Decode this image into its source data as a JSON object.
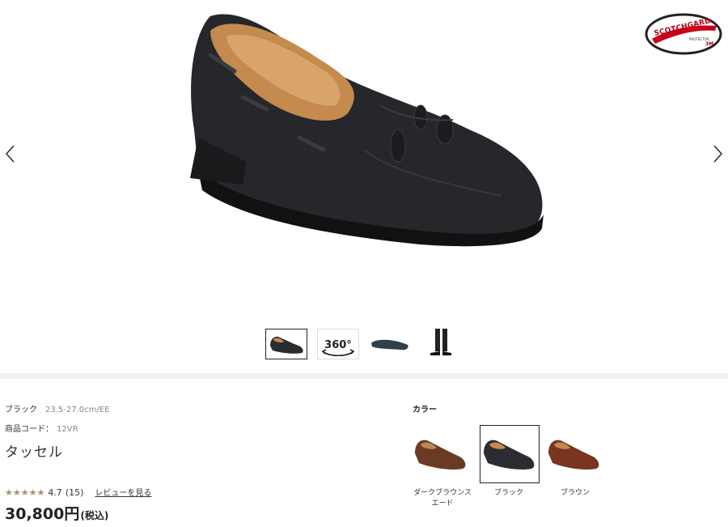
{
  "badge": {
    "brand": "SCOTCHGARD",
    "sub": "PROTECTOR",
    "maker": "3M"
  },
  "nav": {
    "prev_icon": "chevron-left-icon",
    "next_icon": "chevron-right-icon"
  },
  "thumbnails": [
    {
      "kind": "shoe-photo",
      "selected": true
    },
    {
      "kind": "360-view",
      "label": "360°"
    },
    {
      "kind": "sole-photo"
    },
    {
      "kind": "worn-photo"
    }
  ],
  "product": {
    "color_name": "ブラック",
    "size_range": "23.5-27.0cm/EE",
    "code_label": "商品コード：",
    "code": "12VR",
    "title": "タッセル",
    "rating_stars": "★★★★★",
    "rating": "4.7",
    "review_count": "(15)",
    "review_link": "レビューを見る",
    "price": "30,800円",
    "tax": "(税込)"
  },
  "colors": {
    "label": "カラー",
    "options": [
      {
        "name": "ダークブラウンスエード",
        "line1": "ダークブラウンス",
        "line2": "エード",
        "swatch": "#6b3a22",
        "selected": false
      },
      {
        "name": "ブラック",
        "line1": "ブラック",
        "line2": "",
        "swatch": "#2b2d33",
        "selected": true
      },
      {
        "name": "ブラウン",
        "line1": "ブラウン",
        "line2": "",
        "swatch": "#7a3520",
        "selected": false
      }
    ]
  }
}
